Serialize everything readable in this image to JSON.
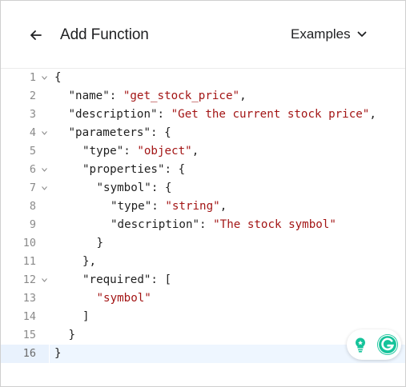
{
  "header": {
    "title": "Add Function",
    "back_icon": "arrow-left-icon",
    "examples_label": "Examples",
    "examples_icon": "chevron-down-icon"
  },
  "editor": {
    "active_line": 16,
    "lines": [
      {
        "n": "1",
        "fold": true,
        "indent": 0,
        "tokens": [
          {
            "t": "p",
            "v": "{"
          }
        ]
      },
      {
        "n": "2",
        "fold": false,
        "indent": 1,
        "tokens": [
          {
            "t": "k",
            "v": "\"name\""
          },
          {
            "t": "p",
            "v": ": "
          },
          {
            "t": "s",
            "v": "\"get_stock_price\""
          },
          {
            "t": "p",
            "v": ","
          }
        ]
      },
      {
        "n": "3",
        "fold": false,
        "indent": 1,
        "tokens": [
          {
            "t": "k",
            "v": "\"description\""
          },
          {
            "t": "p",
            "v": ": "
          },
          {
            "t": "s",
            "v": "\"Get the current stock price\""
          },
          {
            "t": "p",
            "v": ","
          }
        ]
      },
      {
        "n": "4",
        "fold": true,
        "indent": 1,
        "tokens": [
          {
            "t": "k",
            "v": "\"parameters\""
          },
          {
            "t": "p",
            "v": ": {"
          }
        ]
      },
      {
        "n": "5",
        "fold": false,
        "indent": 2,
        "tokens": [
          {
            "t": "k",
            "v": "\"type\""
          },
          {
            "t": "p",
            "v": ": "
          },
          {
            "t": "s",
            "v": "\"object\""
          },
          {
            "t": "p",
            "v": ","
          }
        ]
      },
      {
        "n": "6",
        "fold": true,
        "indent": 2,
        "tokens": [
          {
            "t": "k",
            "v": "\"properties\""
          },
          {
            "t": "p",
            "v": ": {"
          }
        ]
      },
      {
        "n": "7",
        "fold": true,
        "indent": 3,
        "tokens": [
          {
            "t": "k",
            "v": "\"symbol\""
          },
          {
            "t": "p",
            "v": ": {"
          }
        ]
      },
      {
        "n": "8",
        "fold": false,
        "indent": 4,
        "tokens": [
          {
            "t": "k",
            "v": "\"type\""
          },
          {
            "t": "p",
            "v": ": "
          },
          {
            "t": "s",
            "v": "\"string\""
          },
          {
            "t": "p",
            "v": ","
          }
        ]
      },
      {
        "n": "9",
        "fold": false,
        "indent": 4,
        "tokens": [
          {
            "t": "k",
            "v": "\"description\""
          },
          {
            "t": "p",
            "v": ": "
          },
          {
            "t": "s",
            "v": "\"The stock symbol\""
          }
        ]
      },
      {
        "n": "10",
        "fold": false,
        "indent": 3,
        "tokens": [
          {
            "t": "p",
            "v": "}"
          }
        ]
      },
      {
        "n": "11",
        "fold": false,
        "indent": 2,
        "tokens": [
          {
            "t": "p",
            "v": "},"
          }
        ]
      },
      {
        "n": "12",
        "fold": true,
        "indent": 2,
        "tokens": [
          {
            "t": "k",
            "v": "\"required\""
          },
          {
            "t": "p",
            "v": ": ["
          }
        ]
      },
      {
        "n": "13",
        "fold": false,
        "indent": 3,
        "tokens": [
          {
            "t": "s",
            "v": "\"symbol\""
          }
        ]
      },
      {
        "n": "14",
        "fold": false,
        "indent": 2,
        "tokens": [
          {
            "t": "p",
            "v": "]"
          }
        ]
      },
      {
        "n": "15",
        "fold": false,
        "indent": 1,
        "tokens": [
          {
            "t": "p",
            "v": "}"
          }
        ]
      },
      {
        "n": "16",
        "fold": false,
        "indent": 0,
        "tokens": [
          {
            "t": "p",
            "v": "}"
          }
        ]
      }
    ]
  },
  "extensions": [
    {
      "name": "lightbulb-icon",
      "color": "#15c39a"
    },
    {
      "name": "grammarly-icon",
      "color": "#15c39a"
    }
  ],
  "colors": {
    "string": "#a31515",
    "active_line": "#eef6ff",
    "accent": "#15c39a"
  }
}
